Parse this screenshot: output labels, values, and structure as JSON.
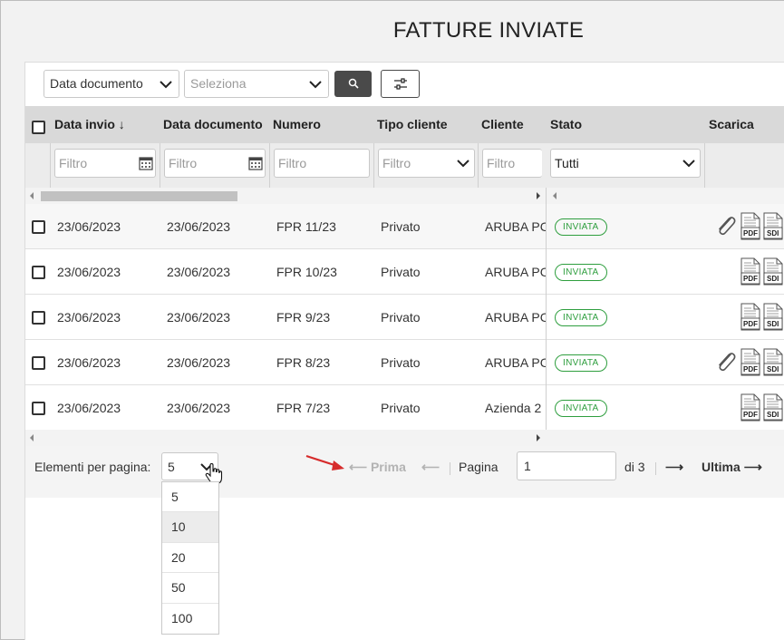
{
  "page_title": "FATTURE INVIATE",
  "toolbar": {
    "field_select": "Data documento",
    "value_select_placeholder": "Seleziona",
    "search_icon": "search-icon",
    "filter_icon": "sliders-icon"
  },
  "table": {
    "columns": [
      "Data invio",
      "Data documento",
      "Numero",
      "Tipo cliente",
      "Cliente",
      "Stato",
      "Scarica"
    ],
    "sort_indicator": "↓",
    "filters": {
      "data_invio": "Filtro",
      "data_documento": "Filtro",
      "numero": "Filtro",
      "tipo_cliente": "Filtro",
      "cliente": "Filtro",
      "stato": "Tutti"
    },
    "rows": [
      {
        "data_invio": "23/06/2023",
        "data_documento": "23/06/2023",
        "numero": "FPR 11/23",
        "tipo_cliente": "Privato",
        "cliente": "ARUBA PC",
        "stato": "INVIATA",
        "attachment": true
      },
      {
        "data_invio": "23/06/2023",
        "data_documento": "23/06/2023",
        "numero": "FPR 10/23",
        "tipo_cliente": "Privato",
        "cliente": "ARUBA PC",
        "stato": "INVIATA",
        "attachment": false
      },
      {
        "data_invio": "23/06/2023",
        "data_documento": "23/06/2023",
        "numero": "FPR 9/23",
        "tipo_cliente": "Privato",
        "cliente": "ARUBA PC",
        "stato": "INVIATA",
        "attachment": false
      },
      {
        "data_invio": "23/06/2023",
        "data_documento": "23/06/2023",
        "numero": "FPR 8/23",
        "tipo_cliente": "Privato",
        "cliente": "ARUBA PC",
        "stato": "INVIATA",
        "attachment": true
      },
      {
        "data_invio": "23/06/2023",
        "data_documento": "23/06/2023",
        "numero": "FPR 7/23",
        "tipo_cliente": "Privato",
        "cliente": "Azienda 2",
        "stato": "INVIATA",
        "attachment": false
      }
    ],
    "download_labels": {
      "pdf": "PDF",
      "sdi": "SDI"
    }
  },
  "pagination": {
    "per_page_label": "Elementi per pagina:",
    "per_page_value": "5",
    "per_page_options": [
      "5",
      "10",
      "20",
      "50",
      "100"
    ],
    "highlighted_option": "10",
    "first_label": "Prima",
    "page_label": "Pagina",
    "current_page": "1",
    "total_label": "di 3",
    "last_label": "Ultima",
    "prev_arrow": "⟵",
    "next_arrow": "⟶",
    "first_arrow": "⟵",
    "last_arrow": "⟶"
  },
  "colors": {
    "status_green": "#2e9e3e",
    "annotation_arrow": "#d62b2b",
    "header_bg": "#d9d9d9"
  }
}
